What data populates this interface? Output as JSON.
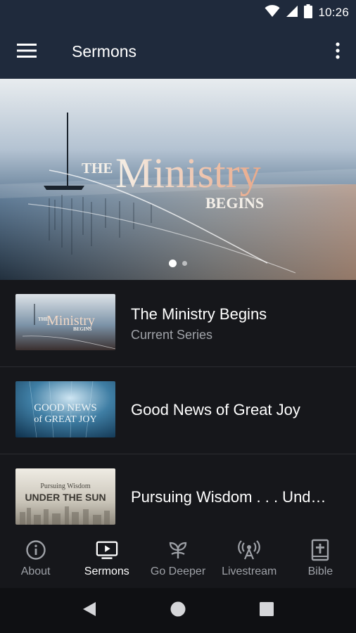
{
  "status": {
    "time": "10:26"
  },
  "app_bar": {
    "title": "Sermons"
  },
  "hero": {
    "title_small": "THE",
    "title_large": "Ministry",
    "title_sub": "BEGINS",
    "page_count": 2,
    "active_page": 1
  },
  "series": [
    {
      "title": "The Ministry Begins",
      "subtitle": "Current Series",
      "thumb_text": [
        "THE",
        "Ministry",
        "BEGINS"
      ]
    },
    {
      "title": "Good News of Great Joy",
      "subtitle": "",
      "thumb_text": [
        "GOOD NEWS",
        "of GREAT JOY"
      ]
    },
    {
      "title": "Pursuing Wisdom . . . Und…",
      "subtitle": "",
      "thumb_text": [
        "Pursuing Wisdom",
        "UNDER THE SUN"
      ]
    }
  ],
  "bottom_nav": [
    {
      "label": "About",
      "icon": "info-icon"
    },
    {
      "label": "Sermons",
      "icon": "tv-play-icon",
      "active": true
    },
    {
      "label": "Go Deeper",
      "icon": "sprout-icon"
    },
    {
      "label": "Livestream",
      "icon": "broadcast-icon"
    },
    {
      "label": "Bible",
      "icon": "bible-icon"
    }
  ],
  "colors": {
    "app_bar": "#1f2a3c",
    "background": "#16171b",
    "text_secondary": "#a0a3a9"
  }
}
